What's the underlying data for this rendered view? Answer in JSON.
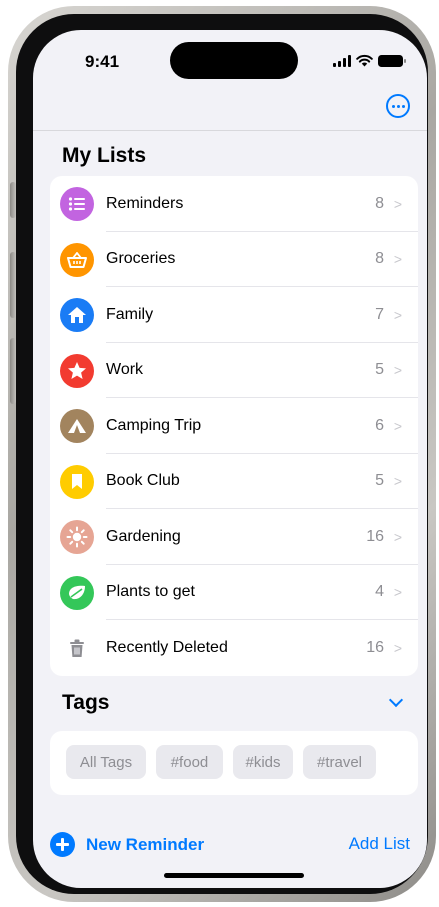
{
  "status_bar": {
    "time": "9:41"
  },
  "sections": {
    "my_lists_title": "My Lists",
    "tags_title": "Tags"
  },
  "lists": [
    {
      "name": "Reminders",
      "count": "8",
      "icon": "list-bullet-icon",
      "color": "#c264e0"
    },
    {
      "name": "Groceries",
      "count": "8",
      "icon": "basket-icon",
      "color": "#ff9500"
    },
    {
      "name": "Family",
      "count": "7",
      "icon": "house-icon",
      "color": "#1a7cf5"
    },
    {
      "name": "Work",
      "count": "5",
      "icon": "star-icon",
      "color": "#f23b30"
    },
    {
      "name": "Camping Trip",
      "count": "6",
      "icon": "tent-icon",
      "color": "#a2845e"
    },
    {
      "name": "Book Club",
      "count": "5",
      "icon": "bookmark-icon",
      "color": "#ffcc00"
    },
    {
      "name": "Gardening",
      "count": "16",
      "icon": "sun-icon",
      "color": "#e6a594"
    },
    {
      "name": "Plants to get",
      "count": "4",
      "icon": "leaf-icon",
      "color": "#34c759"
    },
    {
      "name": "Recently Deleted",
      "count": "16",
      "icon": "trash-icon",
      "color": "#8e8e93"
    }
  ],
  "tags": [
    "All Tags",
    "#food",
    "#kids",
    "#travel"
  ],
  "toolbar": {
    "new_reminder": "New Reminder",
    "add_list": "Add List"
  },
  "accent_color": "#007aff"
}
